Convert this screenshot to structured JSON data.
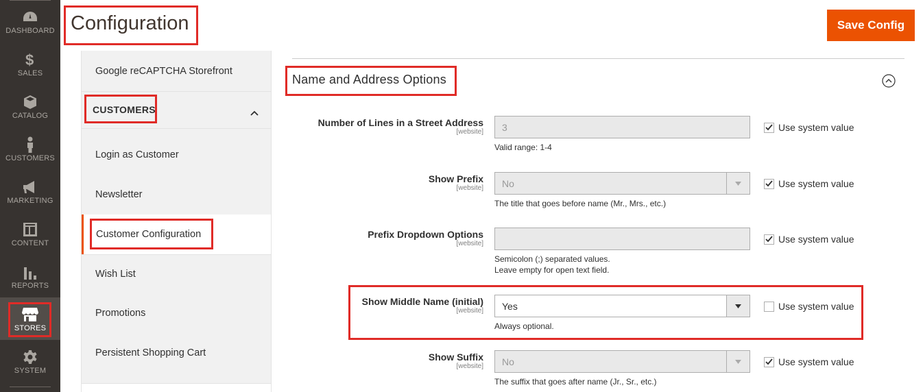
{
  "menu": {
    "items": [
      {
        "label": "DASHBOARD",
        "icon": "dashboard-icon"
      },
      {
        "label": "SALES",
        "icon": "dollar-icon"
      },
      {
        "label": "CATALOG",
        "icon": "box-icon"
      },
      {
        "label": "CUSTOMERS",
        "icon": "person-icon"
      },
      {
        "label": "MARKETING",
        "icon": "megaphone-icon"
      },
      {
        "label": "CONTENT",
        "icon": "layout-icon"
      },
      {
        "label": "REPORTS",
        "icon": "bar-chart-icon"
      },
      {
        "label": "STORES",
        "icon": "store-icon"
      },
      {
        "label": "SYSTEM",
        "icon": "gear-icon"
      }
    ]
  },
  "header": {
    "title": "Configuration",
    "save_label": "Save Config"
  },
  "nav": {
    "top_link": "Google reCAPTCHA Storefront",
    "section_title": "CUSTOMERS",
    "items": [
      "Login as Customer",
      "Newsletter",
      "Customer Configuration",
      "Wish List",
      "Promotions",
      "Persistent Shopping Cart"
    ]
  },
  "section": {
    "title": "Name and Address Options",
    "use_system_label": "Use system value",
    "fields": [
      {
        "label": "Number of Lines in a Street Address",
        "scope": "[website]",
        "value": "3",
        "notes": [
          "Valid range: 1-4"
        ],
        "use_system": true
      },
      {
        "label": "Show Prefix",
        "scope": "[website]",
        "value": "No",
        "notes": [
          "The title that goes before name (Mr., Mrs., etc.)"
        ],
        "use_system": true
      },
      {
        "label": "Prefix Dropdown Options",
        "scope": "[website]",
        "value": "",
        "notes": [
          "Semicolon (;) separated values.",
          "Leave empty for open text field."
        ],
        "use_system": true
      },
      {
        "label": "Show Middle Name (initial)",
        "scope": "[website]",
        "value": "Yes",
        "notes": [
          "Always optional."
        ],
        "use_system": false
      },
      {
        "label": "Show Suffix",
        "scope": "[website]",
        "value": "No",
        "notes": [
          "The suffix that goes after name (Jr., Sr., etc.)"
        ],
        "use_system": true
      }
    ]
  },
  "colors": {
    "accent": "#eb5202",
    "menu_bg": "#373330",
    "highlight": "#e02b27"
  }
}
